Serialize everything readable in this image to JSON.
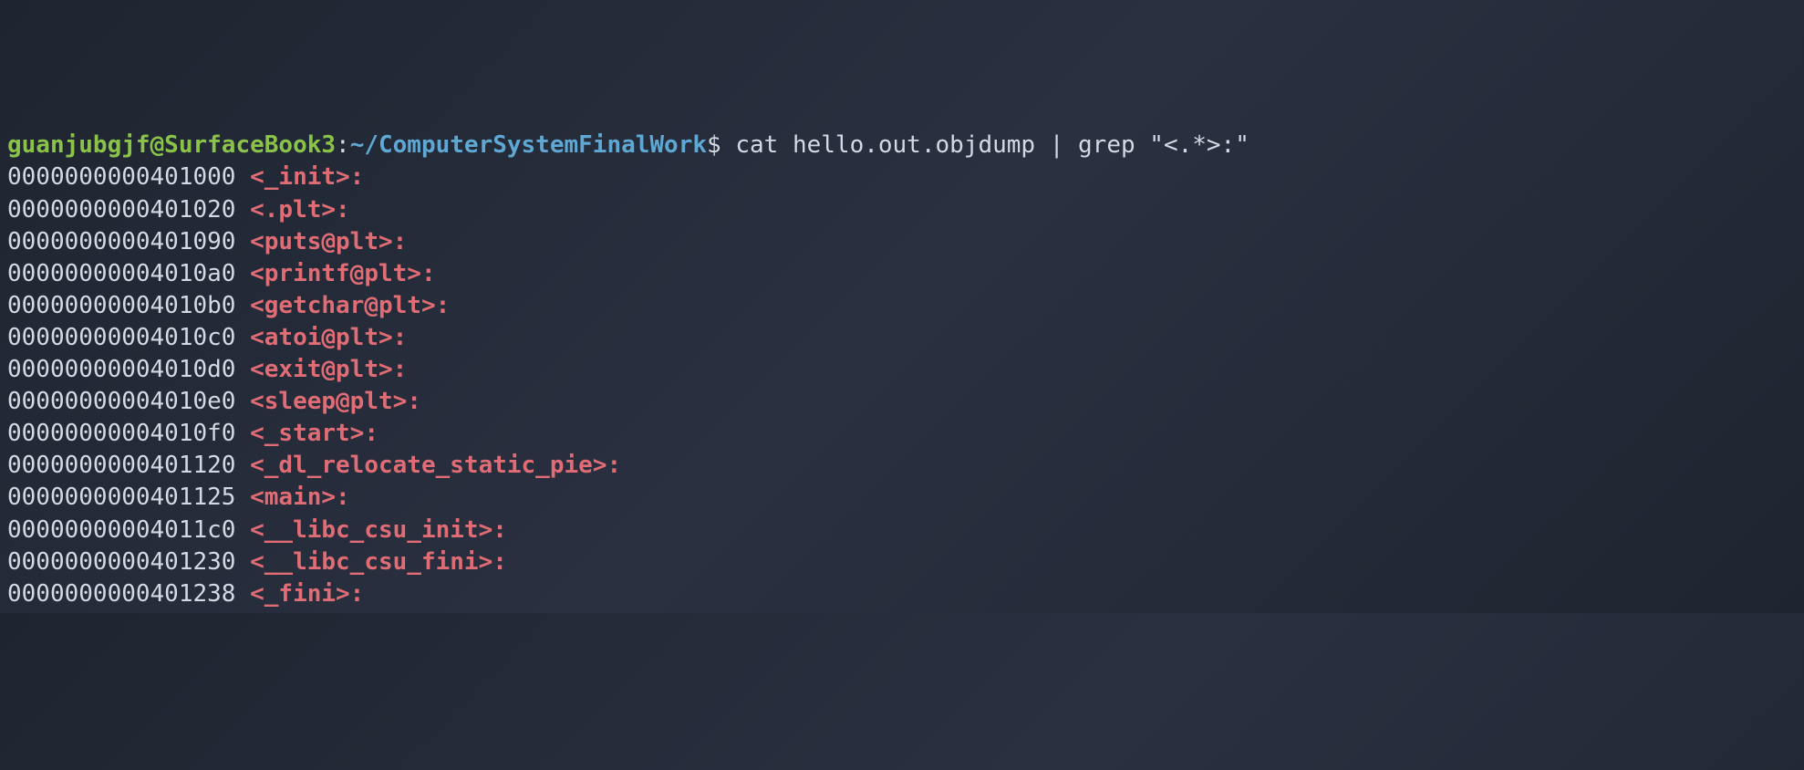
{
  "prompt": {
    "user_host": "guanjubgjf@SurfaceBook3",
    "colon": ":",
    "path": "~/ComputerSystemFinalWork",
    "dollar": "$ ",
    "command": "cat hello.out.objdump | grep \"<.*>:\""
  },
  "lines": [
    {
      "addr": "0000000000401000",
      "symbol": "<_init>:"
    },
    {
      "addr": "0000000000401020",
      "symbol": "<.plt>:"
    },
    {
      "addr": "0000000000401090",
      "symbol": "<puts@plt>:"
    },
    {
      "addr": "00000000004010a0",
      "symbol": "<printf@plt>:"
    },
    {
      "addr": "00000000004010b0",
      "symbol": "<getchar@plt>:"
    },
    {
      "addr": "00000000004010c0",
      "symbol": "<atoi@plt>:"
    },
    {
      "addr": "00000000004010d0",
      "symbol": "<exit@plt>:"
    },
    {
      "addr": "00000000004010e0",
      "symbol": "<sleep@plt>:"
    },
    {
      "addr": "00000000004010f0",
      "symbol": "<_start>:"
    },
    {
      "addr": "0000000000401120",
      "symbol": "<_dl_relocate_static_pie>:"
    },
    {
      "addr": "0000000000401125",
      "symbol": "<main>:"
    },
    {
      "addr": "00000000004011c0",
      "symbol": "<__libc_csu_init>:"
    },
    {
      "addr": "0000000000401230",
      "symbol": "<__libc_csu_fini>:"
    },
    {
      "addr": "0000000000401238",
      "symbol": "<_fini>:"
    }
  ]
}
